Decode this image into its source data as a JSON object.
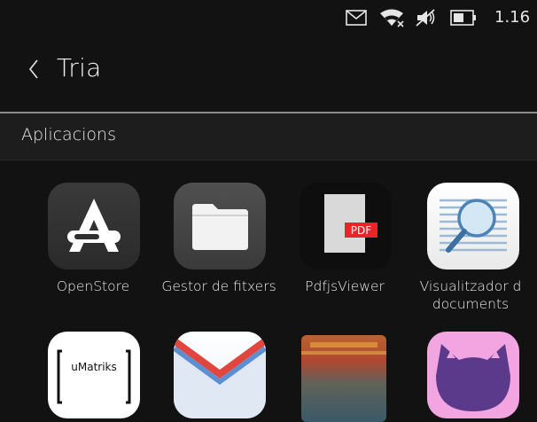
{
  "status": {
    "time": "1.16",
    "icons": [
      "envelope-icon",
      "wifi-icon",
      "speaker-muted-icon",
      "battery-icon"
    ]
  },
  "header": {
    "title": "Tria",
    "back_icon": "chevron-left-icon"
  },
  "section": {
    "title": "Aplicacions"
  },
  "apps": [
    {
      "label": "OpenStore",
      "icon": "openstore-icon"
    },
    {
      "label": "Gestor de fitxers",
      "icon": "folder-icon"
    },
    {
      "label": "PdfjsViewer",
      "icon": "pdf-icon",
      "badge": "PDF"
    },
    {
      "label": "Visualitzador d\ndocuments",
      "icon": "document-viewer-icon"
    },
    {
      "label": "",
      "icon": "umatriks-icon",
      "icon_text": "uMatriks"
    },
    {
      "label": "",
      "icon": "mail-icon"
    },
    {
      "label": "",
      "icon": "painting-icon"
    },
    {
      "label": "",
      "icon": "cat-icon"
    }
  ],
  "colors": {
    "background": "#121212",
    "section_bg": "#1d1d1d",
    "pdf_red": "#e8252b",
    "cat_pink": "#f2a5e0"
  }
}
